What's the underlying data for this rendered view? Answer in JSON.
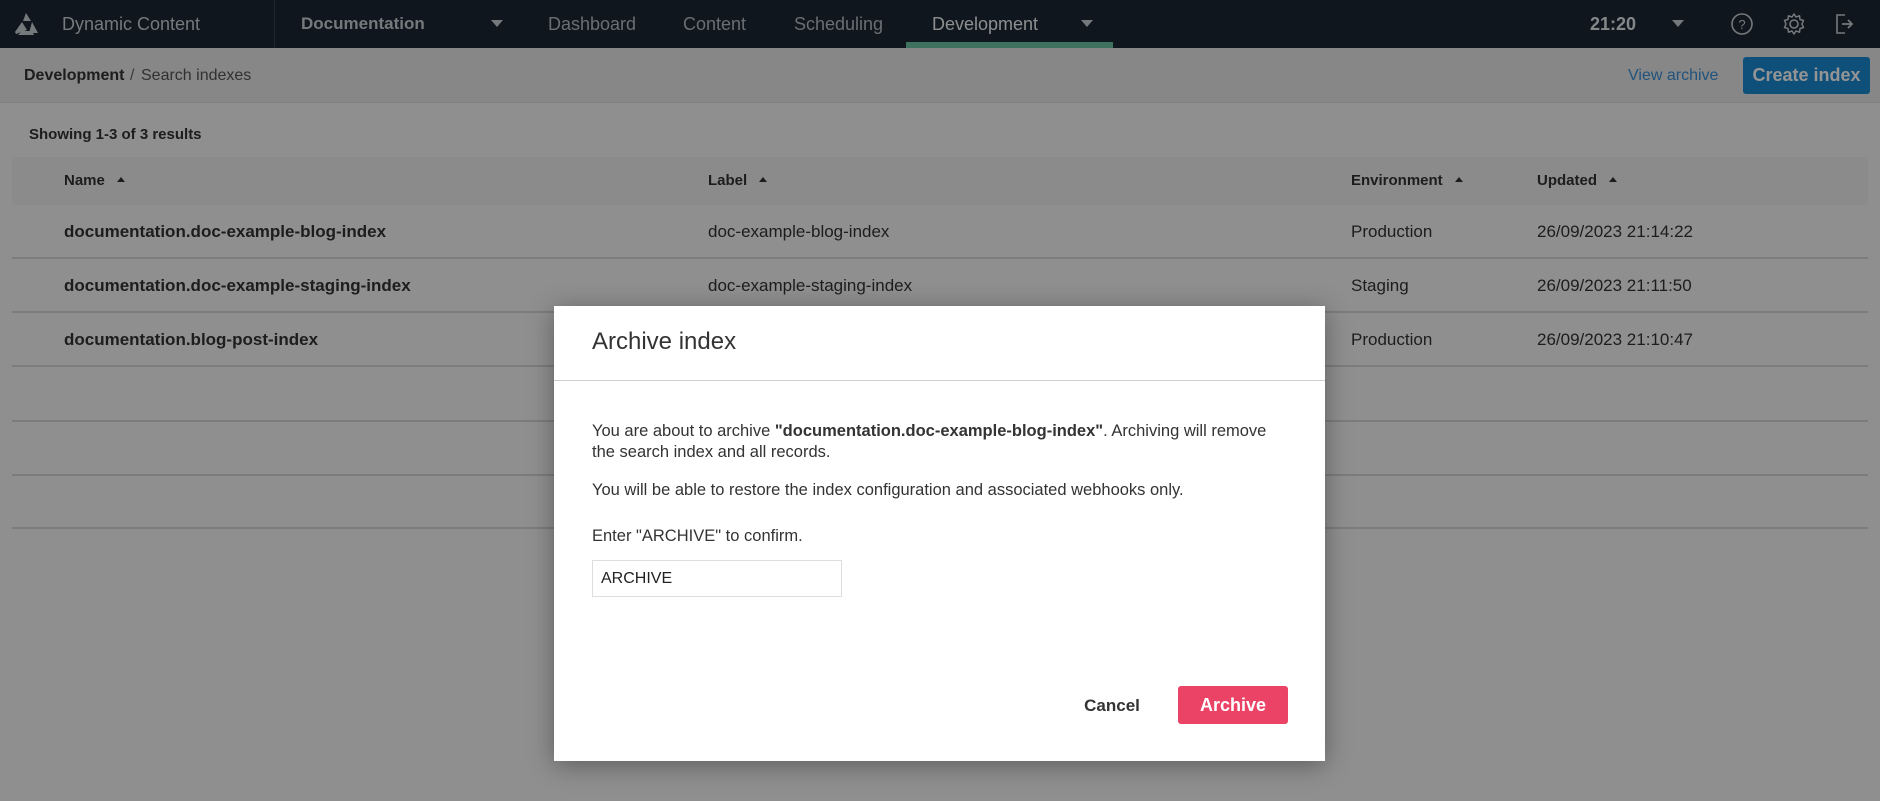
{
  "topnav": {
    "app_title": "Dynamic Content",
    "hub": "Documentation",
    "tabs": [
      {
        "label": "Dashboard",
        "active": false
      },
      {
        "label": "Content",
        "active": false
      },
      {
        "label": "Scheduling",
        "active": false
      },
      {
        "label": "Development",
        "active": true
      }
    ],
    "time": "21:20",
    "icons": [
      "help-icon",
      "settings-gear-icon",
      "logout-icon"
    ],
    "accent_color": "#6cc4a2"
  },
  "subheader": {
    "breadcrumb": {
      "root": "Development",
      "separator": "/",
      "current": "Search indexes"
    },
    "view_archive_label": "View archive",
    "create_index_label": "Create index"
  },
  "results": {
    "summary": "Showing 1-3 of 3 results"
  },
  "table": {
    "columns": [
      "Name",
      "Label",
      "Environment",
      "Updated"
    ],
    "rows": [
      {
        "name": "documentation.doc-example-blog-index",
        "label": "doc-example-blog-index",
        "environment": "Production",
        "updated": "26/09/2023 21:14:22"
      },
      {
        "name": "documentation.doc-example-staging-index",
        "label": "doc-example-staging-index",
        "environment": "Staging",
        "updated": "26/09/2023 21:11:50"
      },
      {
        "name": "documentation.blog-post-index",
        "label": "",
        "environment": "Production",
        "updated": "26/09/2023 21:10:47"
      }
    ]
  },
  "modal": {
    "title": "Archive index",
    "p1_prefix": "You are about to archive ",
    "p1_target": "\"documentation.doc-example-blog-index\"",
    "p1_suffix": ". Archiving will remove the search index and all records.",
    "p2": "You will be able to restore the index configuration and associated webhooks only.",
    "confirm_label": "Enter \"ARCHIVE\" to confirm.",
    "confirm_value": "ARCHIVE",
    "cancel_label": "Cancel",
    "archive_label": "Archive",
    "danger_color": "#ea4366"
  }
}
